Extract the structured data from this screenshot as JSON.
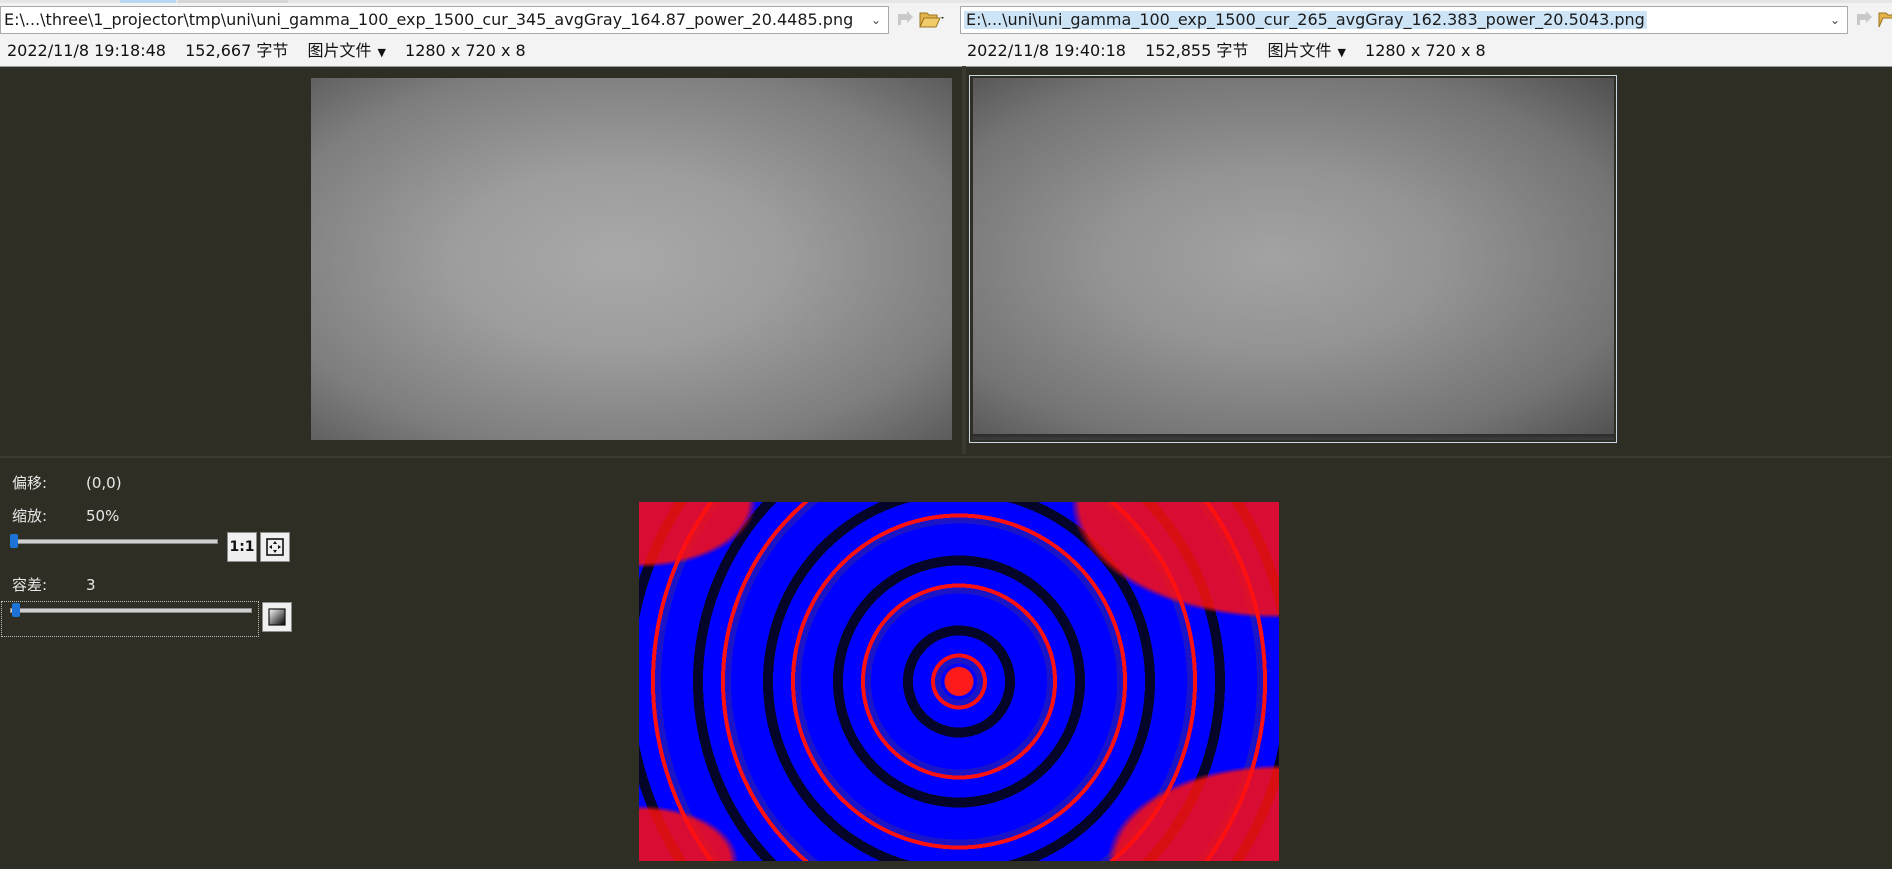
{
  "left": {
    "path": "E:\\...\\three\\1_projector\\tmp\\uni\\uni_gamma_100_exp_1500_cur_345_avgGray_164.87_power_20.4485.png",
    "date": "2022/11/8 19:18:48",
    "size": "152,667 字节",
    "type": "图片文件",
    "dims": "1280 x 720 x 8"
  },
  "right": {
    "path": "E:\\...\\uni\\uni_gamma_100_exp_1500_cur_265_avgGray_162.383_power_20.5043.png",
    "date": "2022/11/8 19:40:18",
    "size": "152,855 字节",
    "type": "图片文件",
    "dims": "1280 x 720 x 8"
  },
  "controls": {
    "offset_label": "偏移:",
    "offset_value": "(0,0)",
    "zoom_label": "缩放:",
    "zoom_value": "50%",
    "zoom_level": 0.0,
    "one_to_one_label": "1:1",
    "tolerance_label": "容差:",
    "tolerance_value": "3",
    "tolerance_level": 0.02
  },
  "icons": {
    "nav": "arrow-next-icon",
    "folder": "folder-open-icon",
    "fit": "fit-to-window-icon",
    "gradient": "gradient-icon",
    "dropdown": "chevron-down-icon"
  },
  "colors": {
    "background": "#2f2e24",
    "toolbar": "#f3f3f3",
    "diff_same": "#0000ff",
    "diff_different": "#ff0000",
    "diff_black": "#000000"
  }
}
